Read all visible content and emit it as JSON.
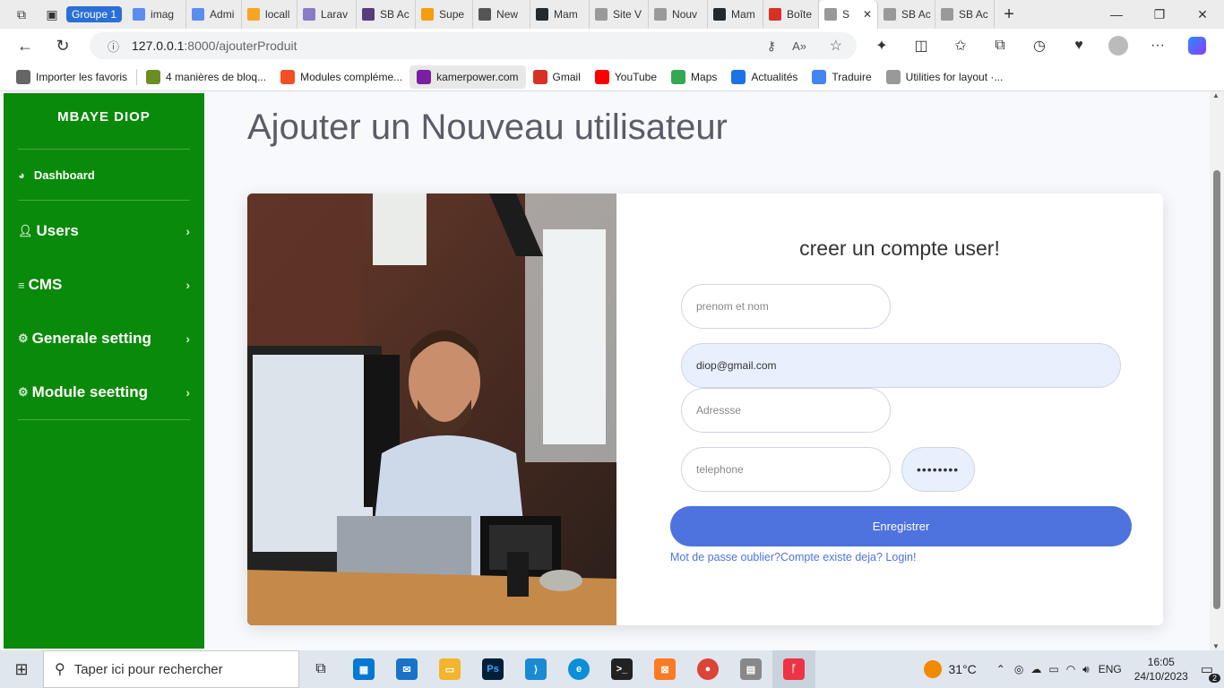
{
  "browser": {
    "tab_group": "Groupe 1",
    "tabs": [
      {
        "label": "imag",
        "icon": "search-icon"
      },
      {
        "label": "Admi",
        "icon": "search-icon"
      },
      {
        "label": "locall",
        "icon": "phpmyadmin-icon"
      },
      {
        "label": "Larav",
        "icon": "b-icon"
      },
      {
        "label": "SB Ac",
        "icon": "bootstrap-icon"
      },
      {
        "label": "Supe",
        "icon": "k-icon"
      },
      {
        "label": "New",
        "icon": "vercel-icon"
      },
      {
        "label": "Mam",
        "icon": "github-icon"
      },
      {
        "label": "Site V",
        "icon": "page-icon"
      },
      {
        "label": "Nouv",
        "icon": "page-icon"
      },
      {
        "label": "Mam",
        "icon": "github-icon"
      },
      {
        "label": "Boîte",
        "icon": "gmail-icon"
      },
      {
        "label": "S",
        "icon": "page-icon",
        "active": true
      },
      {
        "label": "SB Ac",
        "icon": "page-icon"
      },
      {
        "label": "SB Ac",
        "icon": "page-icon"
      }
    ],
    "url_host": "127.0.0.1",
    "url_path": ":8000/ajouterProduit",
    "bookmarks": [
      {
        "label": "Importer les favoris",
        "icon": "import-icon"
      },
      {
        "label": "4 manières de bloq...",
        "icon": "wikihow-icon"
      },
      {
        "label": "Modules compléme...",
        "icon": "microsoft-icon"
      },
      {
        "label": "kamerpower.com",
        "icon": "kamerpower-icon"
      },
      {
        "label": "Gmail",
        "icon": "gmail-icon"
      },
      {
        "label": "YouTube",
        "icon": "youtube-icon"
      },
      {
        "label": "Maps",
        "icon": "maps-icon"
      },
      {
        "label": "Actualités",
        "icon": "news-icon"
      },
      {
        "label": "Traduire",
        "icon": "translate-icon"
      },
      {
        "label": "Utilities for layout ·...",
        "icon": "page-icon"
      }
    ]
  },
  "sidebar": {
    "brand": "MBAYE DIOP",
    "dashboard": "Dashboard",
    "items": [
      {
        "label": "Users",
        "icon": "user-icon"
      },
      {
        "label": "CMS",
        "icon": "bars-icon"
      },
      {
        "label": "Generale setting",
        "icon": "cogs-icon"
      },
      {
        "label": "Module seetting",
        "icon": "cog-icon"
      }
    ]
  },
  "main": {
    "title": "Ajouter un Nouveau utilisateur",
    "form": {
      "heading": "creer un compte user!",
      "name_placeholder": "prenom et nom",
      "email_value": "diop@gmail.com",
      "address_placeholder": "Adressse",
      "phone_placeholder": "telephone",
      "password_value": "••••••••",
      "submit_label": "Enregistrer",
      "links_text": "Mot de passe oublier?Compte existe deja? Login!"
    }
  },
  "taskbar": {
    "search_placeholder": "Taper ici pour rechercher",
    "weather": "31°C",
    "lang": "ENG",
    "time": "16:05",
    "date": "24/10/2023",
    "notifications": "2"
  },
  "colors": {
    "sidebar": "#0a8a0a",
    "primary": "#4e73df",
    "tab_group": "#2b6fd6"
  }
}
